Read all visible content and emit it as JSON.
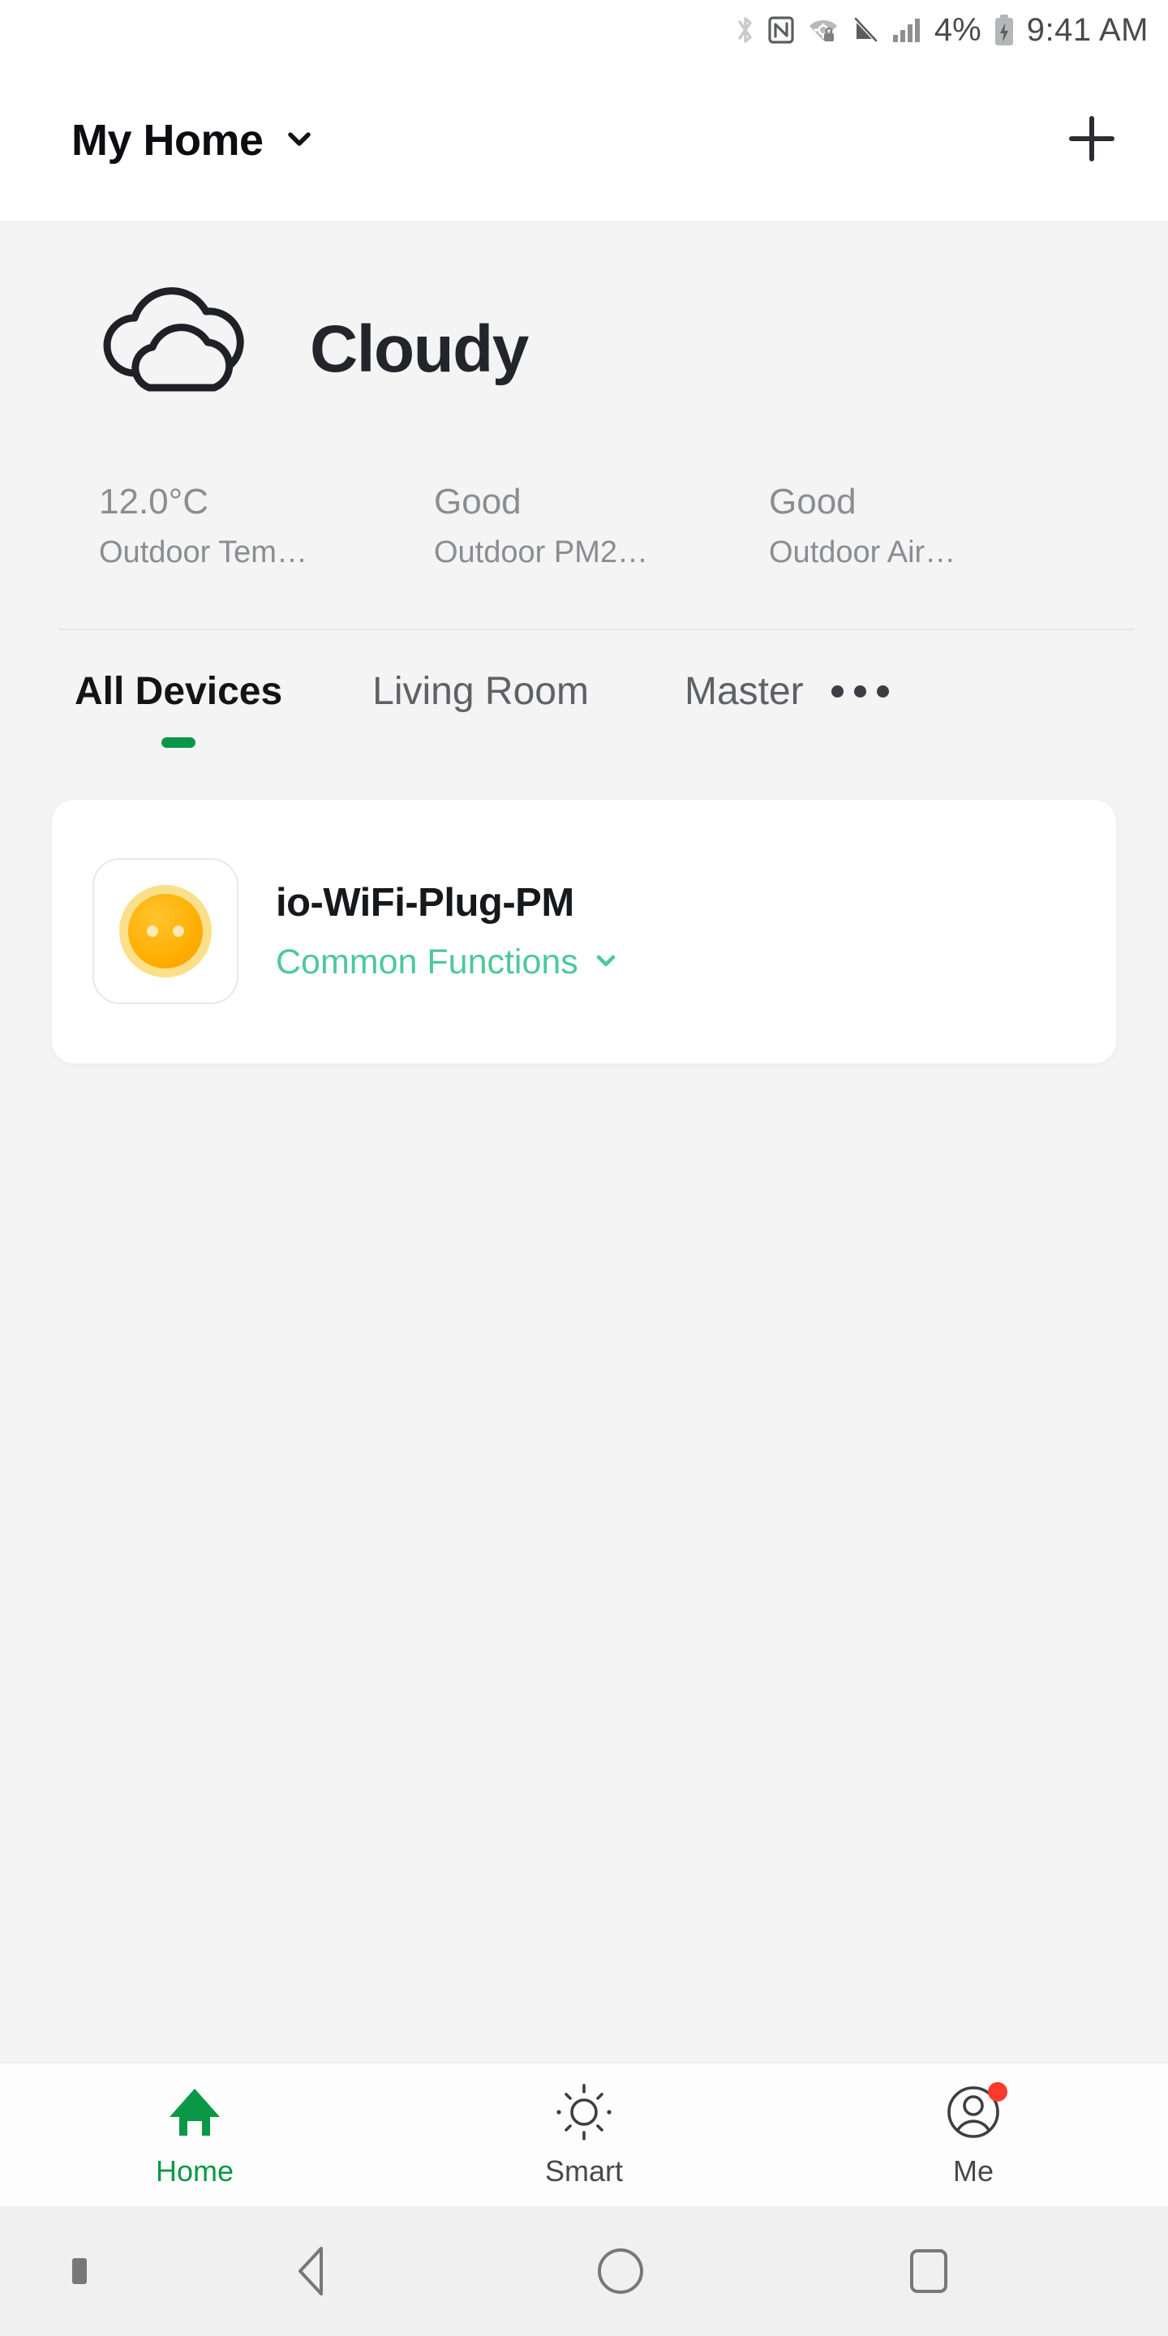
{
  "statusbar": {
    "icons": [
      "bluetooth-icon",
      "nfc-icon",
      "wifi-secured-icon",
      "silent-mode-icon",
      "cellular-signal-icon"
    ],
    "battery_percent": "4%",
    "battery_state_icon": "battery-charging-icon",
    "time": "9:41 AM"
  },
  "header": {
    "home_name": "My Home",
    "chevron_icon": "chevron-down-icon",
    "add_icon": "plus-icon"
  },
  "weather": {
    "condition": "Cloudy",
    "condition_icon": "cloudy-icon",
    "stats": [
      {
        "value": "12.0°C",
        "label": "Outdoor Tem…"
      },
      {
        "value": "Good",
        "label": "Outdoor PM2…"
      },
      {
        "value": "Good",
        "label": "Outdoor Air…"
      }
    ]
  },
  "tabs": {
    "items": [
      {
        "label": "All Devices",
        "active": true
      },
      {
        "label": "Living Room",
        "active": false
      },
      {
        "label": "Master",
        "active": false
      }
    ],
    "more_icon": "more-horizontal-icon",
    "indicator_color": "#0a9847"
  },
  "devices": [
    {
      "name": "io-WiFi-Plug-PM",
      "icon": "smart-plug-icon",
      "function_label": "Common Functions",
      "function_chevron_icon": "chevron-down-icon",
      "function_color": "#4cc999"
    }
  ],
  "bottomnav": {
    "items": [
      {
        "label": "Home",
        "icon": "home-icon",
        "active": true,
        "badge": false
      },
      {
        "label": "Smart",
        "icon": "sun-icon",
        "active": false,
        "badge": false
      },
      {
        "label": "Me",
        "icon": "person-icon",
        "active": false,
        "badge": true
      }
    ],
    "active_color": "#0a9847",
    "badge_color": "#fc3b2d"
  },
  "androidnav": {
    "pin_icon": "hide-navbar-icon",
    "back_icon": "back-triangle-icon",
    "home_icon": "home-circle-icon",
    "recents_icon": "recents-square-icon"
  }
}
